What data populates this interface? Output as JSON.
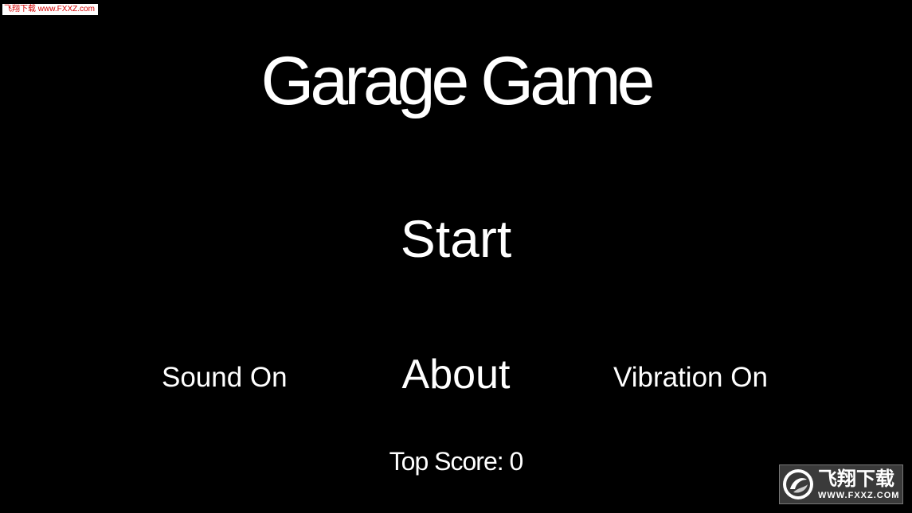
{
  "game": {
    "title": "Garage Game",
    "menu": {
      "start_label": "Start",
      "sound_label": "Sound On",
      "about_label": "About",
      "vibration_label": "Vibration On"
    },
    "top_score_label": "Top Score: 0"
  },
  "watermark": {
    "top_left_text": "飞翔下载 www.FXXZ.com",
    "badge_text": "飞翔下载",
    "badge_url": "WWW.FXXZ.COM",
    "logo_icon": "swirl-logo-icon"
  },
  "colors": {
    "background": "#000000",
    "text": "#ffffff",
    "watermark_red": "#d40000"
  }
}
